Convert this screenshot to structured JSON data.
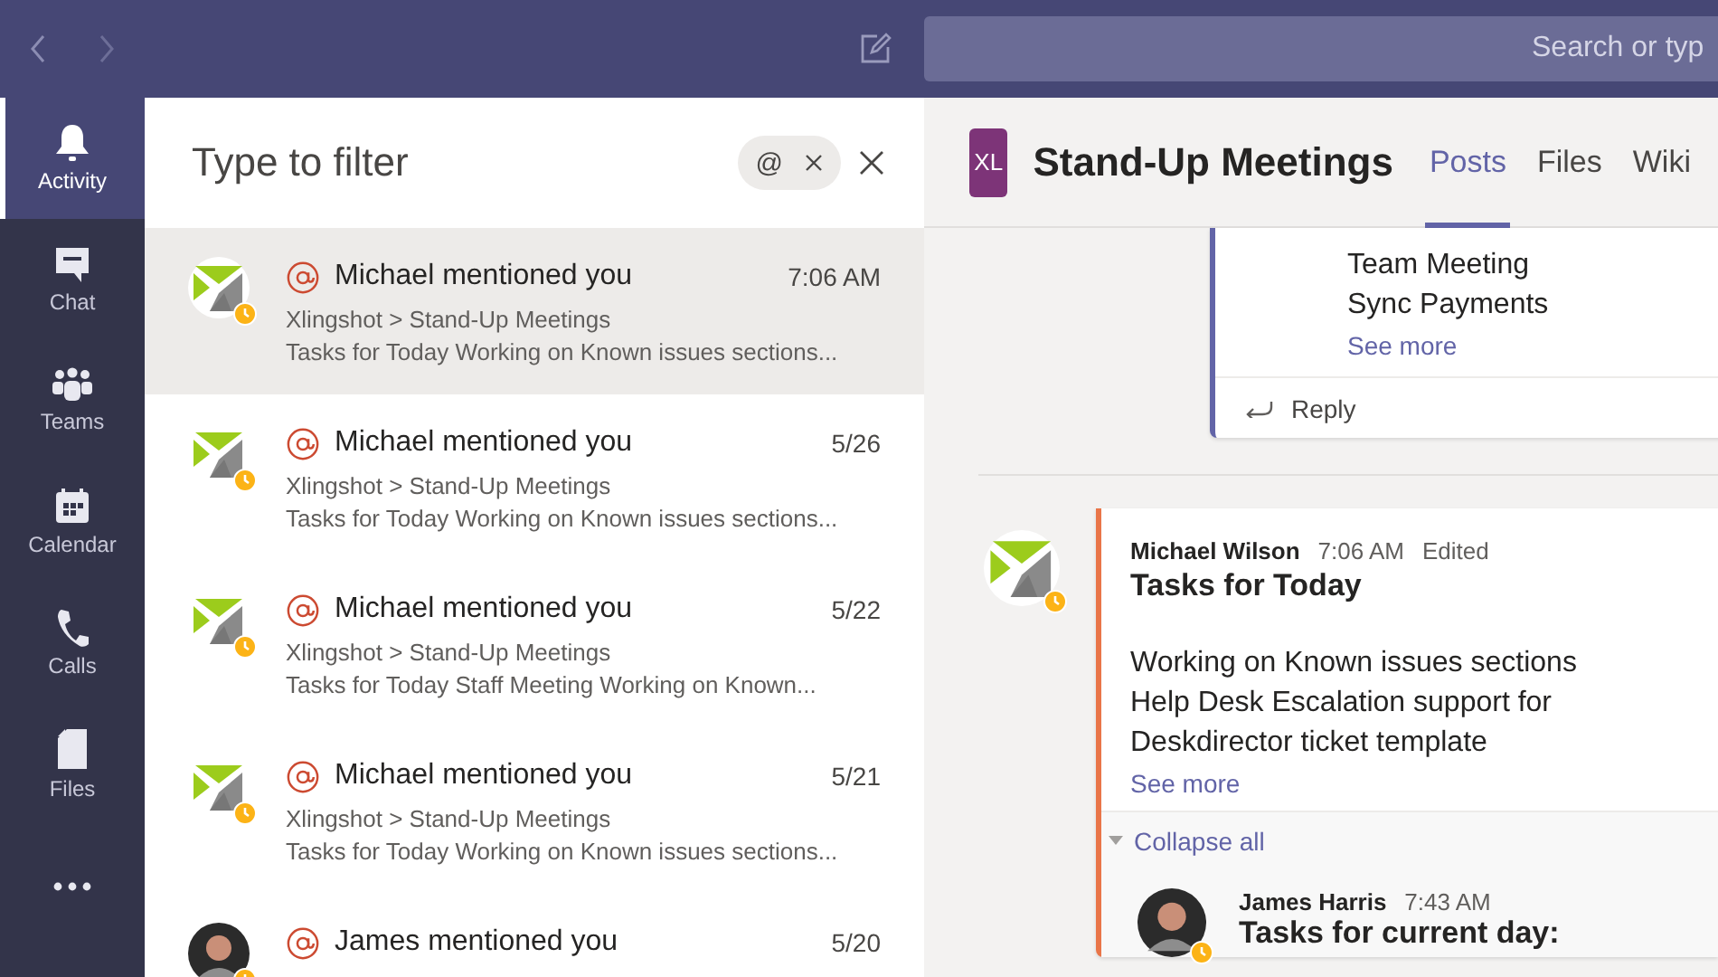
{
  "top_bar": {
    "search": {
      "placeholder": "Search or typ"
    }
  },
  "rail": {
    "items": [
      {
        "kind": "activity",
        "label": "Activity",
        "selected": true
      },
      {
        "kind": "chat",
        "label": "Chat",
        "selected": false
      },
      {
        "kind": "teams",
        "label": "Teams",
        "selected": false
      },
      {
        "kind": "calendar",
        "label": "Calendar",
        "selected": false
      },
      {
        "kind": "calls",
        "label": "Calls",
        "selected": false
      },
      {
        "kind": "files",
        "label": "Files",
        "selected": false
      },
      {
        "kind": "more",
        "selected": false
      }
    ]
  },
  "activity": {
    "filter": {
      "placeholder": "Type to filter",
      "chip": "@"
    },
    "items": [
      {
        "kind": "logo",
        "title": "Michael mentioned you",
        "time": "7:06 AM",
        "path": "Xlingshot > Stand-Up Meetings",
        "preview": "Tasks for Today Working on Known issues sections...",
        "selected": true
      },
      {
        "kind": "logo",
        "title": "Michael mentioned you",
        "time": "5/26",
        "path": "Xlingshot > Stand-Up Meetings",
        "preview": "Tasks for Today Working on Known issues sections...",
        "selected": false
      },
      {
        "kind": "logo",
        "title": "Michael mentioned you",
        "time": "5/22",
        "path": "Xlingshot > Stand-Up Meetings",
        "preview": "Tasks for Today Staff Meeting Working on Known...",
        "selected": false
      },
      {
        "kind": "logo",
        "title": "Michael mentioned you",
        "time": "5/21",
        "path": "Xlingshot > Stand-Up Meetings",
        "preview": "Tasks for Today Working on Known issues sections...",
        "selected": false
      },
      {
        "kind": "person",
        "title": "James mentioned you",
        "time": "5/20",
        "selected": false
      }
    ]
  },
  "channel": {
    "team_initials": "XL",
    "name": "Stand-Up Meetings",
    "tabs": [
      {
        "label": "Posts",
        "selected": true
      },
      {
        "label": "Files",
        "selected": false
      },
      {
        "label": "Wiki",
        "selected": false
      }
    ],
    "posts": [
      {
        "color": "#6264a7",
        "lines": [
          "Team Meeting",
          "Sync Payments"
        ],
        "see_more": "See more",
        "reply": "Reply"
      },
      {
        "color": "#e97548",
        "kind": "logo",
        "author": "Michael Wilson",
        "time": "7:06 AM",
        "edited": "Edited",
        "title": "Tasks for Today",
        "lines": [
          "Working on Known issues sections",
          "Help Desk Escalation support for",
          "Deskdirector ticket template"
        ],
        "see_more": "See more",
        "collapse": "Collapse all",
        "replies": [
          {
            "kind": "person",
            "author": "James Harris",
            "time": "7:43 AM",
            "title": "Tasks for current day:"
          }
        ]
      }
    ]
  }
}
